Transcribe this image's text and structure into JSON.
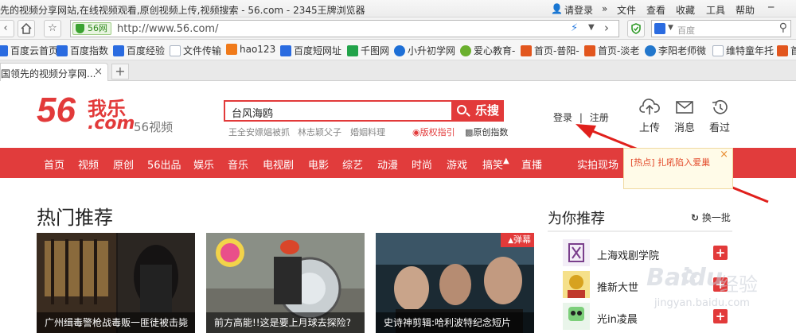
{
  "browser": {
    "window_title": "先的视频分享网站,在线视频观看,原创视频上传,视频搜索 - 56.com - 2345王牌浏览器",
    "login_label": "请登录",
    "menu": [
      "文件",
      "查看",
      "收藏",
      "工具",
      "帮助"
    ],
    "badge_label": "56网",
    "url": "http://www.56.com/",
    "search_engine_label": "百度",
    "bookmarks": [
      {
        "label": "百度云首页",
        "color": "#2a6be0"
      },
      {
        "label": "百度指数",
        "color": "#2a6be0"
      },
      {
        "label": "百度经验",
        "color": "#2a6be0"
      },
      {
        "label": "文件传输",
        "color": "#aab4c2"
      },
      {
        "label": "hao123",
        "color": "#f07a1a"
      },
      {
        "label": "百度短网址",
        "color": "#2a6be0"
      },
      {
        "label": "千图网",
        "color": "#22a34a"
      },
      {
        "label": "小升初学网",
        "color": "#1e6fd6"
      },
      {
        "label": "爱心教育-",
        "color": "#6bb02e"
      },
      {
        "label": "首页-普阳-",
        "color": "#e2561e"
      },
      {
        "label": "首页-淡老",
        "color": "#e2561e"
      },
      {
        "label": "李阳老师微",
        "color": "#2277cc"
      },
      {
        "label": "维特童年托",
        "color": "#aab4c2"
      },
      {
        "label": "首",
        "color": "#e2561e"
      }
    ],
    "tab_title": "国领先的视频分享网...",
    "new_tab_symbol": "+",
    "tab_close_symbol": "×"
  },
  "header": {
    "logo_main": "56",
    "logo_wole": "我乐",
    "logo_com": ".com",
    "logo_sub": "56视频",
    "search_value": "台风海鸥",
    "search_button": "乐搜",
    "hot_keywords": [
      "王全安嫖娼被抓",
      "林志颖父子",
      "婚姻料理"
    ],
    "link_copyright": "版权指引",
    "link_original": "原创指数",
    "login": "登录",
    "separator": "|",
    "register": "注册",
    "tools": [
      {
        "label": "上传",
        "icon": "upload-icon"
      },
      {
        "label": "消息",
        "icon": "mail-icon"
      },
      {
        "label": "看过",
        "icon": "history-icon"
      }
    ]
  },
  "nav": {
    "items": [
      "首页",
      "视频",
      "原创",
      "56出品",
      "娱乐",
      "音乐",
      "电视剧",
      "电影",
      "综艺",
      "动漫",
      "时尚",
      "游戏",
      "搞笑",
      "直播"
    ],
    "extra": "实拍现场"
  },
  "popup": {
    "text": "[热点] 扎吼陷入爱巢",
    "close": "×"
  },
  "hot": {
    "title": "热门推荐",
    "items": [
      {
        "caption": "广州缉毒警枪战毒贩一匪徒被击毙",
        "badge": ""
      },
      {
        "caption": "前方高能!!这是要上月球去探险?",
        "badge": ""
      },
      {
        "caption": "史诗神剪辑:哈利波特纪念短片",
        "badge": "弹幕"
      }
    ]
  },
  "recommend": {
    "title": "为你推荐",
    "refresh": "换一批",
    "items": [
      {
        "name": "上海戏剧学院"
      },
      {
        "name": "推新大世"
      },
      {
        "name": "光in凌晨"
      }
    ]
  },
  "watermark": {
    "logo": "Baidu",
    "logo_suffix": "经验",
    "domain": "jingyan.baidu.com"
  },
  "colors": {
    "brand_red": "#e13c3c",
    "nav_text": "#ffffff",
    "accent_orange": "#e88a2e"
  }
}
